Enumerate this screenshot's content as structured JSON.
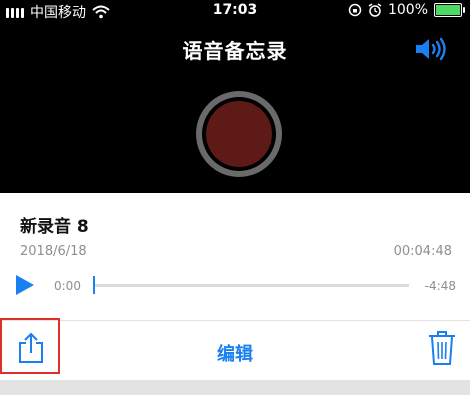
{
  "status_bar": {
    "carrier": "中国移动",
    "time": "17:03",
    "battery": "100%"
  },
  "header": {
    "title": "语音备忘录"
  },
  "memo": {
    "name": "新录音 8",
    "date": "2018/6/18",
    "duration": "00:04:48",
    "elapsed": "0:00",
    "remaining": "-4:48",
    "progress_fraction": 0
  },
  "toolbar": {
    "edit_label": "编辑"
  },
  "colors": {
    "accent": "#1a7ff0",
    "record_button": "#5e1a16",
    "battery": "#4cd964",
    "highlight": "#e0302e"
  },
  "icons": {
    "signal": "signal-bars-icon",
    "wifi": "wifi-icon",
    "rotation_lock": "rotation-lock-icon",
    "alarm": "alarm-icon",
    "speaker": "speaker-icon",
    "play": "play-icon",
    "share": "share-icon",
    "trash": "trash-icon"
  }
}
